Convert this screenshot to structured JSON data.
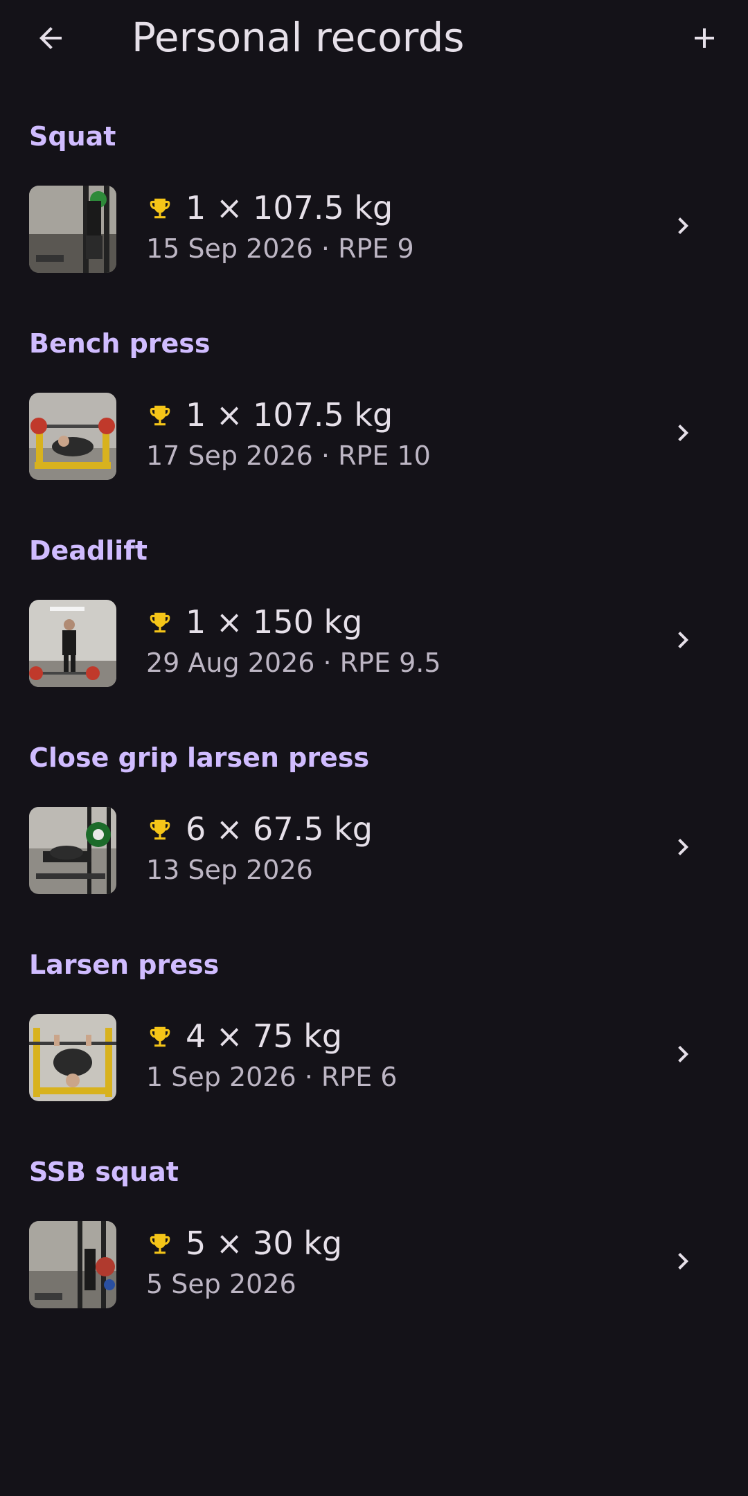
{
  "app_bar": {
    "title": "Personal records",
    "back_icon": "arrow-back-icon",
    "add_icon": "plus-icon"
  },
  "colors": {
    "background": "#141218",
    "section_title": "#D0BCFF",
    "trophy": "#F5C518",
    "primary_text": "#E6E0E9",
    "secondary_text": "#BDB6C4"
  },
  "records": [
    {
      "exercise": "Squat",
      "summary": "1 × 107.5 kg",
      "detail": "15 Sep 2026 · RPE 9",
      "icon": "trophy-icon"
    },
    {
      "exercise": "Bench press",
      "summary": "1 × 107.5 kg",
      "detail": "17 Sep 2026 · RPE 10",
      "icon": "trophy-icon"
    },
    {
      "exercise": "Deadlift",
      "summary": "1 × 150 kg",
      "detail": "29 Aug 2026 · RPE 9.5",
      "icon": "trophy-icon"
    },
    {
      "exercise": "Close grip larsen press",
      "summary": "6 × 67.5 kg",
      "detail": "13 Sep 2026",
      "icon": "trophy-icon"
    },
    {
      "exercise": "Larsen press",
      "summary": "4 × 75 kg",
      "detail": "1 Sep 2026 · RPE 6",
      "icon": "trophy-icon"
    },
    {
      "exercise": "SSB squat",
      "summary": "5 × 30 kg",
      "detail": "5 Sep 2026",
      "icon": "trophy-icon"
    }
  ]
}
